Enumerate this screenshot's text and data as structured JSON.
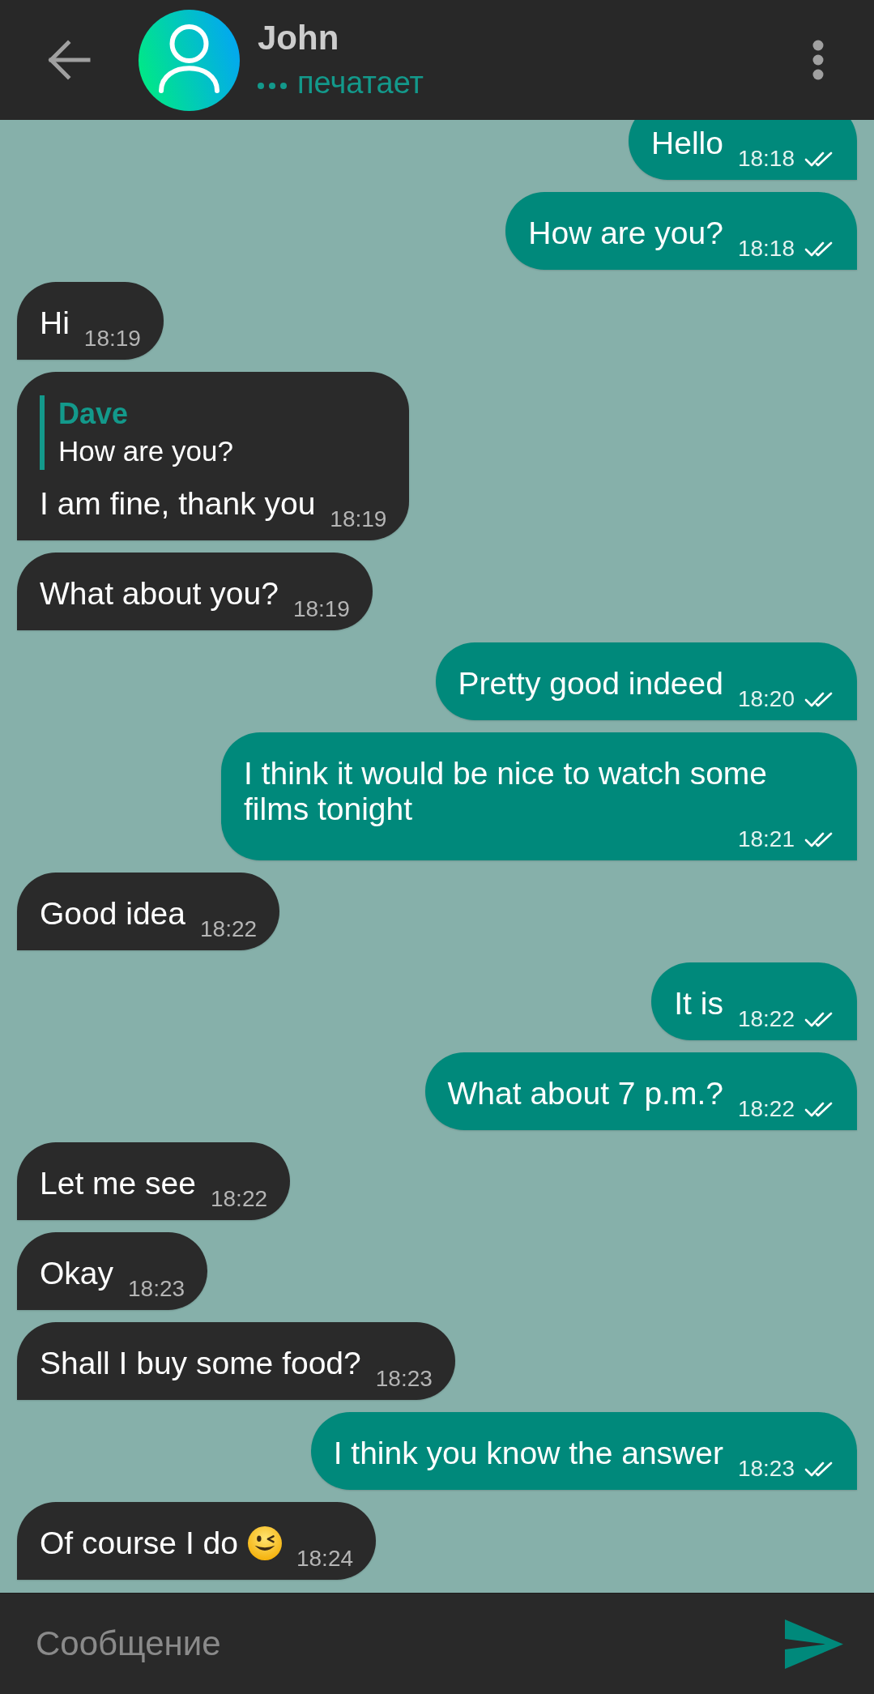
{
  "contact": {
    "name": "John",
    "status": "печатает",
    "typing": true
  },
  "messages": [
    {
      "kind": "outgoing",
      "text": "Hello",
      "time": "18:18",
      "read": true
    },
    {
      "kind": "outgoing",
      "text": "How are you?",
      "time": "18:18",
      "read": true
    },
    {
      "kind": "incoming",
      "text": "Hi",
      "time": "18:19"
    },
    {
      "kind": "incoming",
      "reply_to": {
        "author": "Dave",
        "text": "How are you?"
      },
      "text": "I am fine, thank you",
      "time": "18:19"
    },
    {
      "kind": "incoming",
      "text": "What about you?",
      "time": "18:19"
    },
    {
      "kind": "outgoing",
      "text": "Pretty good indeed",
      "time": "18:20",
      "read": true
    },
    {
      "kind": "outgoing",
      "text": "I think it would be nice to watch some films tonight",
      "time": "18:21",
      "read": true
    },
    {
      "kind": "incoming",
      "text": "Good idea",
      "time": "18:22"
    },
    {
      "kind": "outgoing",
      "text": "It is",
      "time": "18:22",
      "read": true
    },
    {
      "kind": "outgoing",
      "text": "What about 7 p.m.?",
      "time": "18:22",
      "read": true
    },
    {
      "kind": "incoming",
      "text": "Let me see",
      "time": "18:22"
    },
    {
      "kind": "incoming",
      "text": "Okay",
      "time": "18:23"
    },
    {
      "kind": "incoming",
      "text": "Shall I buy some food?",
      "time": "18:23"
    },
    {
      "kind": "outgoing",
      "text": "I think you know the answer",
      "time": "18:23",
      "read": true
    },
    {
      "kind": "incoming",
      "text": "Of course I do",
      "emoji": true,
      "time": "18:24"
    }
  ],
  "composer": {
    "placeholder": "Сообщение"
  }
}
